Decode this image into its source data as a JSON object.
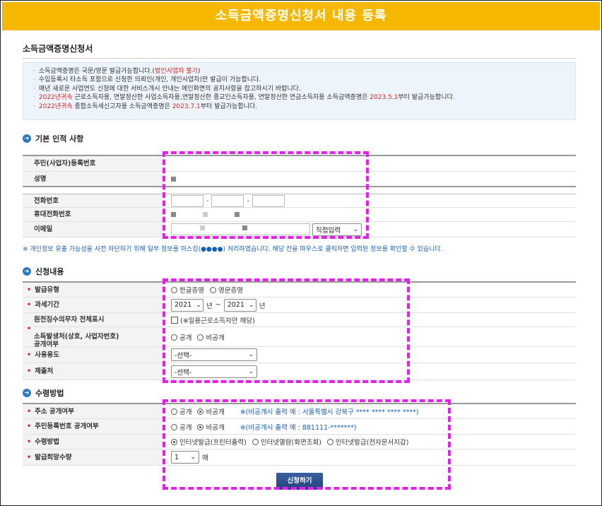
{
  "banner": "소득금액증명신청서 내용 등록",
  "page_title": "소득금액증명신청서",
  "notices": [
    {
      "parts": [
        {
          "t": "소득금액증명은 국문/영문 발급가능합니다.(",
          "red": false
        },
        {
          "t": "법인사업자 불가",
          "red": true
        },
        {
          "t": ")",
          "red": false
        }
      ]
    },
    {
      "parts": [
        {
          "t": "수입등록시 타소득 포함으로 신청한 의뢰인(개인, 개인사업자)만 발급이 가능합니다.",
          "red": false
        }
      ]
    },
    {
      "parts": [
        {
          "t": "매년 새로운 사업연도 신청에 대한 서비스개시 안내는 메인화면의 공지사항을 참고하시기 바랍니다.",
          "red": false
        }
      ]
    },
    {
      "parts": [
        {
          "t": "2022년귀속",
          "red": true
        },
        {
          "t": " 근로소득자용, 연말정산한 사업소득자용,연말정산한 종교인소득자용, 연말정산한 연금소득자용 소득금액증명은 ",
          "red": false
        },
        {
          "t": "2023.5.1",
          "red": true
        },
        {
          "t": "부터 발급가능합니다.",
          "red": false
        }
      ]
    },
    {
      "parts": [
        {
          "t": "2022년귀속",
          "red": true
        },
        {
          "t": " 종합소득세신고자용 소득금액증명은 ",
          "red": false
        },
        {
          "t": "2023.7.1",
          "red": true
        },
        {
          "t": "부터 발급가능합니다.",
          "red": false
        }
      ]
    }
  ],
  "section_basic": "기본 인적 사항",
  "basic": {
    "resident_no_label": "주민(사업자)등록번호",
    "name_label": "성명",
    "phone_label": "전화번호",
    "mobile_label": "휴대전화번호",
    "email_label": "이메일",
    "email_domain_select": "직접입력"
  },
  "privacy_note": "※ 개인정보 유출 가능성을 사전 차단하기 위해 일부 정보를 마스킹(●●●●) 처리하였습니다. 해당 칸을 마우스로 클릭하면 입력된 정보를 확인할 수 있습니다.",
  "section_apply": "신청내용",
  "apply": {
    "issue_type_label": "발급유형",
    "issue_type_options": [
      "한글증명",
      "영문증명"
    ],
    "period_label": "과세기간",
    "period_from": "2021",
    "period_to": "2021",
    "year_unit": "년",
    "tilde": "~",
    "withholding_label": "원천징수의무자 전체표시",
    "withholding_option": "(※일용근로소득자만 해당)",
    "disclose_label_1": "소득발생처(상호, 사업자번호)",
    "disclose_label_2": "공개여부",
    "disclose_options": [
      "공개",
      "비공개"
    ],
    "purpose_label": "사용용도",
    "purpose_value": "-선택-",
    "submit_to_label": "제출처",
    "submit_to_value": "-선택-"
  },
  "section_receive": "수령방법",
  "receive": {
    "address_label": "주소 공개여부",
    "address_options": [
      "공개",
      "비공개"
    ],
    "address_note": "※(비공개시 출력 예 : 서울특별시 강북구 **** **** **** ****)",
    "rrn_label": "주민등록번호 공개여부",
    "rrn_options": [
      "공개",
      "비공개"
    ],
    "rrn_note": "※(비공개시 출력 예 : 881111-*******)",
    "method_label": "수령방법",
    "method_options": [
      "인터넷발급(프린터출력)",
      "인터넷열람(화면조회)",
      "인터넷발급(전자문서지갑)"
    ],
    "qty_label": "발급희망수량",
    "qty_value": "1",
    "qty_unit": "매"
  },
  "submit_label": "신청하기",
  "colors": {
    "banner": "#f6b700",
    "accent_blue": "#1a5fb4",
    "highlight": "#e81ef0",
    "required": "#dd2222"
  }
}
